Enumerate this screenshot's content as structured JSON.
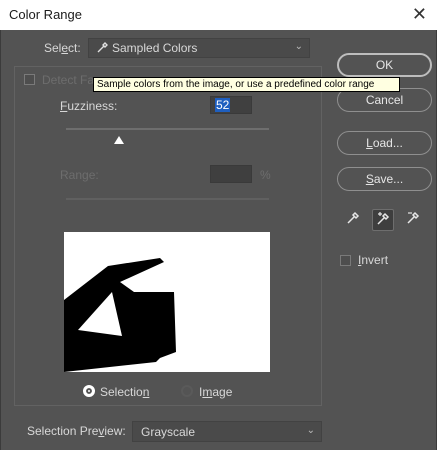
{
  "window": {
    "title": "Color Range",
    "close_glyph": "✕"
  },
  "select": {
    "label_pre": "Sel",
    "label_u": "e",
    "label_post": "ct:",
    "icon": "eyedropper-icon",
    "value": "Sampled Colors"
  },
  "tooltip": {
    "text": "Sample colors from the image, or use a predefined color range"
  },
  "detect_faces": {
    "label": "Detect Fa"
  },
  "fuzziness": {
    "label_u": "F",
    "label_post": "uzziness:",
    "value": "52",
    "slider_fraction": 0.26
  },
  "range": {
    "label": "Range:",
    "value": "",
    "unit": "%"
  },
  "preview": {
    "radio_selection": {
      "label_pre": "Selectio",
      "label_u": "n",
      "checked": true
    },
    "radio_image": {
      "label_pre": "I",
      "label_u": "m",
      "label_post": "age",
      "checked": false
    }
  },
  "buttons": {
    "ok": "OK",
    "cancel": "Cancel",
    "load": {
      "pre": "",
      "u": "L",
      "post": "oad..."
    },
    "save": {
      "pre": "",
      "u": "S",
      "post": "ave..."
    }
  },
  "eyedroppers": [
    "eyedropper-icon",
    "eyedropper-plus-icon",
    "eyedropper-minus-icon"
  ],
  "invert": {
    "label_u": "I",
    "label_post": "nvert",
    "checked": false
  },
  "selection_preview": {
    "label_pre": "Selection Pre",
    "label_u": "v",
    "label_post": "iew:",
    "value": "Grayscale"
  },
  "colors": {
    "dialog_bg": "#535353",
    "tooltip_bg": "#ffffe1",
    "input_highlight": "#1f5fbf"
  }
}
